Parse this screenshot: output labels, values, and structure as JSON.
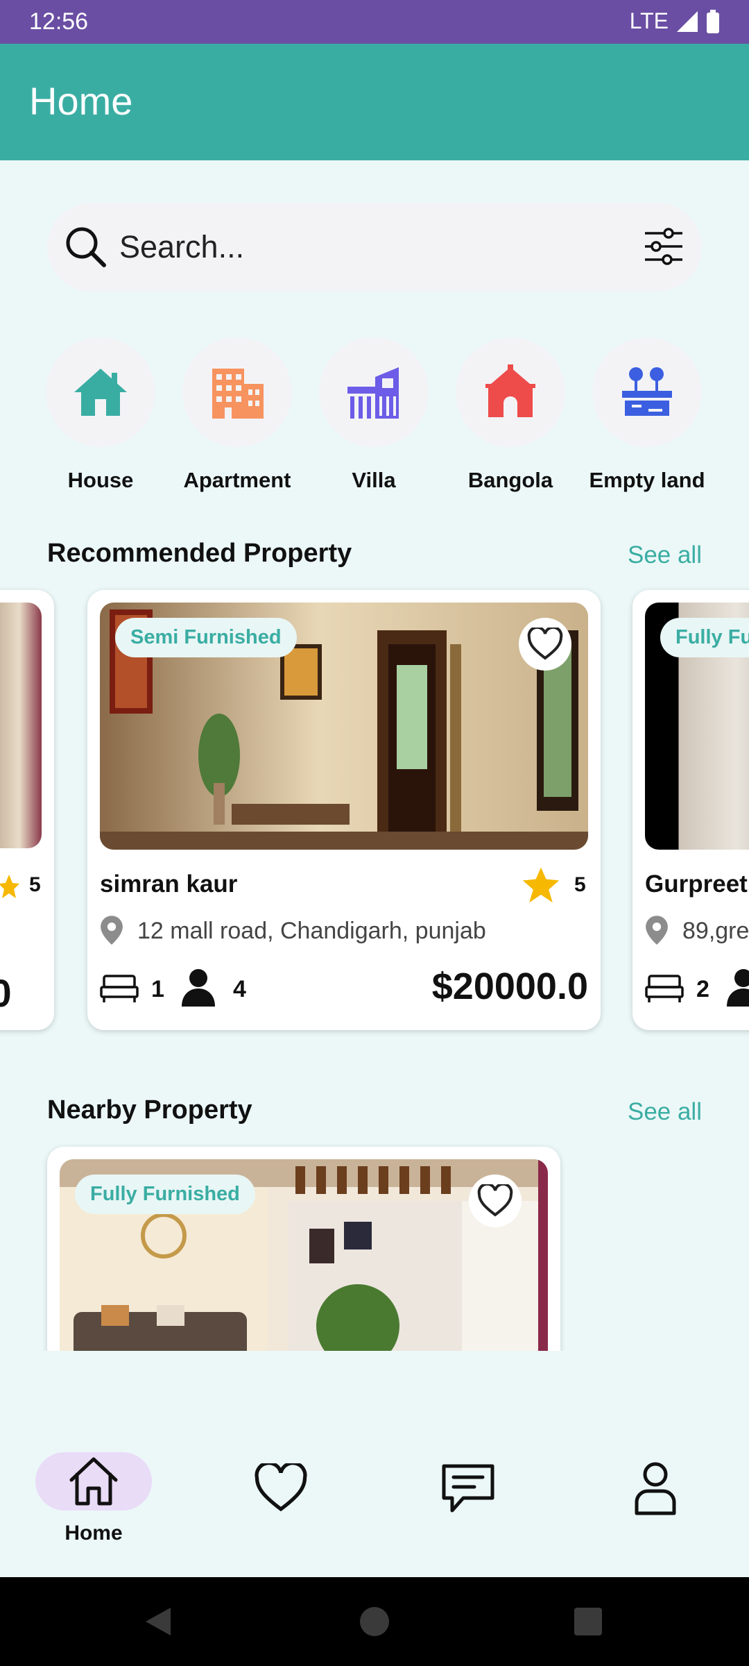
{
  "status": {
    "time": "12:56",
    "network": "LTE"
  },
  "appbar": {
    "title": "Home"
  },
  "search": {
    "placeholder": "Search..."
  },
  "categories": [
    {
      "label": "House",
      "icon": "house-icon",
      "color": "#3aada3"
    },
    {
      "label": "Apartment",
      "icon": "apartment-icon",
      "color": "#f7935f"
    },
    {
      "label": "Villa",
      "icon": "villa-icon",
      "color": "#6c5ce7"
    },
    {
      "label": "Bangola",
      "icon": "bungalow-icon",
      "color": "#ee4b4b"
    },
    {
      "label": "Empty land",
      "icon": "land-icon",
      "color": "#3b5fe0"
    }
  ],
  "recommended": {
    "title": "Recommended Property",
    "see_all": "See all",
    "left_card": {
      "rating": "5",
      "price_fragment": ".0"
    },
    "main_card": {
      "badge": "Semi Furnished",
      "name": "simran kaur",
      "rating": "5",
      "address": "12 mall road, Chandigarh, punjab",
      "beds": "1",
      "guests": "4",
      "price": "$20000.0"
    },
    "right_card": {
      "badge": "Fully Fu",
      "name": "Gurpreet",
      "address": "89,gre",
      "beds": "2"
    }
  },
  "nearby": {
    "title": "Nearby Property",
    "see_all": "See all",
    "card": {
      "badge": "Fully Furnished"
    }
  },
  "bottom_nav": {
    "home_label": "Home"
  },
  "colors": {
    "accent": "#3aada3",
    "status_bar": "#6a4ea3",
    "star": "#f6b800",
    "nav_pill": "#e9dcf7"
  }
}
